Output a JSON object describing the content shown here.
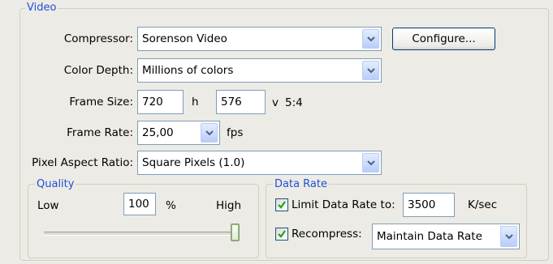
{
  "video_group": {
    "title": "Video"
  },
  "compressor": {
    "label": "Compressor:",
    "value": "Sorenson Video",
    "configure_label": "Configure..."
  },
  "color_depth": {
    "label": "Color Depth:",
    "value": "Millions of colors"
  },
  "frame_size": {
    "label": "Frame Size:",
    "width": "720",
    "h_label": "h",
    "height": "576",
    "v_label": "v",
    "ratio": "5:4"
  },
  "frame_rate": {
    "label": "Frame Rate:",
    "value": "25,00",
    "unit": "fps"
  },
  "pixel_aspect": {
    "label": "Pixel Aspect Ratio:",
    "value": "Square Pixels (1.0)"
  },
  "quality": {
    "title": "Quality",
    "low_label": "Low",
    "value": "100",
    "percent_sign": "%",
    "high_label": "High",
    "slider_level": 1.0
  },
  "data_rate": {
    "title": "Data Rate",
    "limit_label": "Limit Data Rate to:",
    "limit_checked": true,
    "limit_value": "3500",
    "unit": "K/sec",
    "recompress_label": "Recompress:",
    "recompress_checked": true,
    "recompress_value": "Maintain Data Rate"
  },
  "colors": {
    "accent": "#2050d8",
    "panel_bg": "#ecebe5",
    "field_border": "#7f9db9"
  }
}
